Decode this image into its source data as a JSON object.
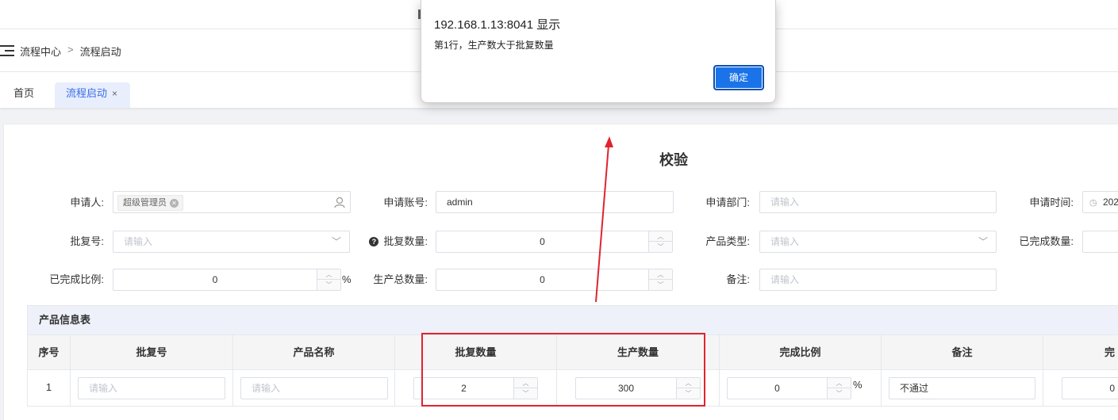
{
  "dialog": {
    "origin": "192.168.1.13:8041 显示",
    "message": "第1行，生产数大于批复数量",
    "ok_label": "确定"
  },
  "breadcrumb": {
    "items": [
      "流程中心",
      "流程启动"
    ],
    "separator": ">"
  },
  "tabs": {
    "home": "首页",
    "active": "流程启动",
    "close": "×"
  },
  "form": {
    "title": "校验",
    "applicant": {
      "label": "申请人:",
      "tag": "超级管理员"
    },
    "account": {
      "label": "申请账号:",
      "value": "admin"
    },
    "dept": {
      "label": "申请部门:",
      "placeholder": "请输入"
    },
    "time": {
      "label": "申请时间:",
      "value": "202"
    },
    "approval_no": {
      "label": "批复号:",
      "placeholder": "请输入"
    },
    "approval_qty": {
      "label": "批复数量:",
      "value": "0"
    },
    "product_type": {
      "label": "产品类型:",
      "placeholder": "请输入"
    },
    "done_qty": {
      "label": "已完成数量:"
    },
    "done_ratio": {
      "label": "已完成比例:",
      "value": "0",
      "unit": "%"
    },
    "total_qty": {
      "label": "生产总数量:",
      "value": "0"
    },
    "remark": {
      "label": "备注:",
      "placeholder": "请输入"
    }
  },
  "table": {
    "title": "产品信息表",
    "columns": [
      "序号",
      "批复号",
      "产品名称",
      "批复数量",
      "生产数量",
      "完成比例",
      "备注",
      "完"
    ],
    "rows": [
      {
        "index": "1",
        "approval_no_placeholder": "请输入",
        "product_name_placeholder": "请输入",
        "approval_qty": "2",
        "production_qty": "300",
        "ratio": "0",
        "ratio_unit": "%",
        "remark": "不通过",
        "done": "0"
      }
    ]
  },
  "colors": {
    "accent": "#3a6ee8",
    "highlight": "#e0242e",
    "dialog_button": "#1a73e8"
  }
}
